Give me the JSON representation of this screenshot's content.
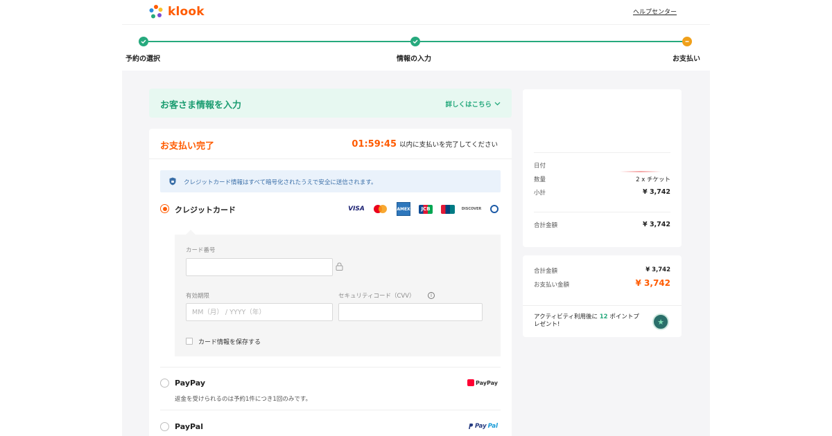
{
  "header": {
    "brand": "klook",
    "help_link": "ヘルプセンター"
  },
  "steps": [
    {
      "label": "予約の選択",
      "status": "done"
    },
    {
      "label": "情報の入力",
      "status": "done"
    },
    {
      "label": "お支払い",
      "status": "current"
    }
  ],
  "customer_info": {
    "title": "お客さま情報を入力",
    "more_link": "詳しくはこちら"
  },
  "payment": {
    "title": "お支払い完了",
    "timer": "01:59:45",
    "timer_suffix": "以内に支払いを完了してください",
    "secure_note": "クレジットカード情報はすべて暗号化されたうえで安全に送信されます。",
    "credit_card": {
      "label": "クレジットカード",
      "brands": [
        "VISA",
        "Mastercard",
        "AMEX",
        "JCB",
        "UnionPay",
        "DISCOVER",
        "Diners Club"
      ],
      "card_number_label": "カード番号",
      "card_number_value": "",
      "expiry_label": "有効期限",
      "expiry_placeholder": "MM（月） / YYYY（年）",
      "cvv_label": "セキュリティコード（CVV）",
      "cvv_value": "",
      "save_card_label": "カード情報を保存する"
    },
    "paypay": {
      "label": "PayPay",
      "note": "返金を受けられるのは予約1件につき1回のみです。",
      "logo_text": "PayPay"
    },
    "paypal": {
      "label": "PayPal",
      "logo_pay": "Pay",
      "logo_pal": "Pal"
    }
  },
  "summary": {
    "date_label": "日付",
    "qty_label": "数量",
    "qty_value": "2 x チケット",
    "subtotal_label": "小計",
    "subtotal_value": "¥ 3,742",
    "total_label": "合計金額",
    "total_value": "¥ 3,742"
  },
  "totals": {
    "total_label": "合計金額",
    "total_value": "¥ 3,742",
    "pay_label": "お支払い金額",
    "pay_value": "¥ 3,742",
    "points_prefix": "アクティビティ利用後に",
    "points_value": "12",
    "points_suffix": "ポイントプレゼント!"
  },
  "colors": {
    "brand_orange": "#ff5b00",
    "step_green": "#26a97d",
    "step_current": "#f0a01a"
  }
}
